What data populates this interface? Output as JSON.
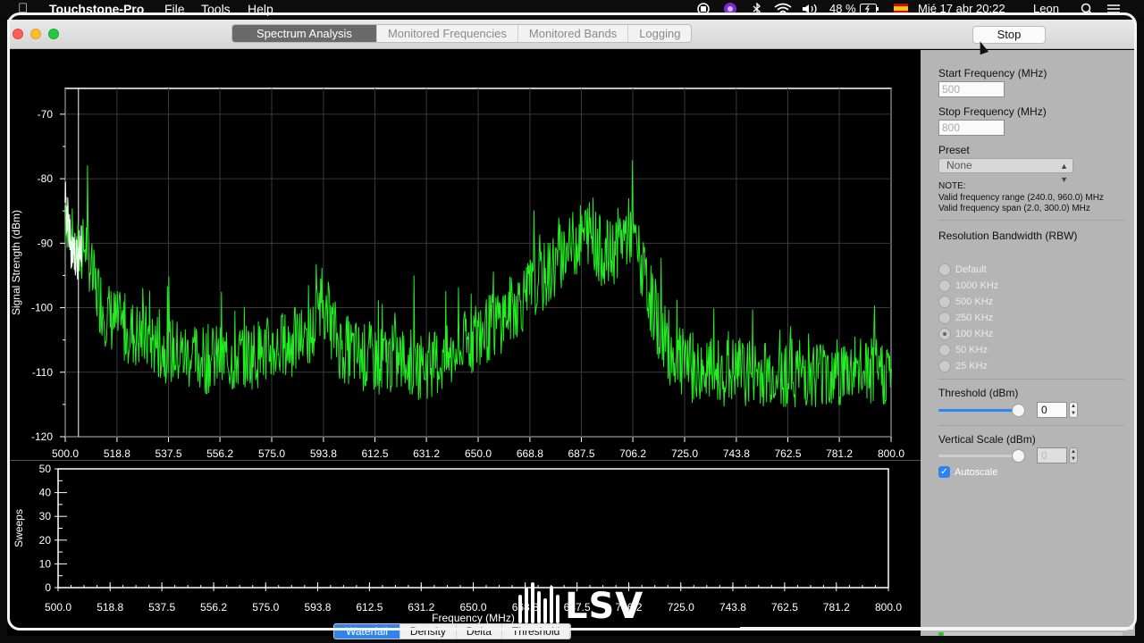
{
  "menubar": {
    "app_name": "Touchstone-Pro",
    "menus": [
      "File",
      "Tools",
      "Help"
    ],
    "battery": "48 %",
    "datetime": "Mié 17 abr  20:22",
    "user": "Leon"
  },
  "window": {
    "tabs": [
      {
        "label": "Spectrum Analysis",
        "active": true
      },
      {
        "label": "Monitored Frequencies",
        "active": false
      },
      {
        "label": "Monitored Bands",
        "active": false
      },
      {
        "label": "Logging",
        "active": false
      }
    ],
    "stop_label": "Stop"
  },
  "panel": {
    "start_freq_label": "Start Frequency (MHz)",
    "start_freq_value": "500",
    "stop_freq_label": "Stop Frequency (MHz)",
    "stop_freq_value": "800",
    "preset_label": "Preset",
    "preset_value": "None",
    "note_title": "NOTE:",
    "note_line1": "Valid frequency range (240.0, 960.0) MHz",
    "note_line2": "Valid frequency span (2.0, 300.0) MHz",
    "rbw_label": "Resolution Bandwidth (RBW)",
    "rbw_options": [
      {
        "label": "Default",
        "selected": false
      },
      {
        "label": "1000 KHz",
        "selected": false
      },
      {
        "label": "500 KHz",
        "selected": false
      },
      {
        "label": "250 KHz",
        "selected": false
      },
      {
        "label": "100 KHz",
        "selected": true
      },
      {
        "label": "50 KHz",
        "selected": false
      },
      {
        "label": "25 KHz",
        "selected": false
      }
    ],
    "threshold_label": "Threshold (dBm)",
    "threshold_value": "0",
    "threshold_level": 0.94,
    "vscale_label": "Vertical Scale (dBm)",
    "vscale_value": "0",
    "vscale_level": 0.94,
    "autoscale_label": "Autoscale",
    "autoscale_checked": true,
    "progress": 0.03
  },
  "view_tabs": [
    {
      "label": "Waterfall",
      "active": true
    },
    {
      "label": "Density",
      "active": false
    },
    {
      "label": "Delta",
      "active": false
    },
    {
      "label": "Threshold",
      "active": false
    }
  ],
  "watermark": {
    "text": "LSV"
  },
  "colors": {
    "trace": "#22ee22",
    "accent": "#2f84ee"
  },
  "chart_data": [
    {
      "type": "line",
      "xlabel": "Frequency (MHz)",
      "ylabel": "Signal Strength (dBm)",
      "xlim": [
        500,
        800
      ],
      "ylim": [
        -120,
        -66
      ],
      "x_ticks": [
        "500.0",
        "518.8",
        "537.5",
        "556.2",
        "575.0",
        "593.8",
        "612.5",
        "631.2",
        "650.0",
        "668.8",
        "687.5",
        "706.2",
        "725.0",
        "743.8",
        "762.5",
        "781.2",
        "800.0"
      ],
      "y_ticks": [
        -70,
        -80,
        -90,
        -100,
        -110,
        -120
      ],
      "grid": true,
      "series": [
        {
          "x": [
            500,
            502,
            504,
            506,
            508,
            510,
            515,
            520,
            525,
            530,
            540,
            550,
            560,
            570,
            580,
            585,
            590,
            593,
            596,
            600,
            605,
            610,
            620,
            630,
            640,
            645,
            650,
            655,
            660,
            665,
            670,
            675,
            680,
            685,
            690,
            694,
            698,
            702,
            706,
            710,
            715,
            720,
            725,
            730,
            740,
            750,
            760,
            770,
            780,
            790,
            800
          ],
          "y": [
            -84,
            -90,
            -92,
            -91,
            -90,
            -96,
            -101,
            -103,
            -104,
            -105,
            -107,
            -108,
            -108,
            -107,
            -106,
            -105,
            -104,
            -98,
            -102,
            -106,
            -107,
            -108,
            -108,
            -109,
            -108,
            -106,
            -104,
            -103,
            -101,
            -99,
            -97,
            -95,
            -92,
            -90,
            -88,
            -91,
            -92,
            -89,
            -88,
            -95,
            -102,
            -107,
            -109,
            -110,
            -110,
            -110,
            -110,
            -110,
            -110,
            -110,
            -110
          ]
        }
      ]
    },
    {
      "type": "heatmap",
      "xlabel": "Frequency (MHz)",
      "ylabel": "Sweeps",
      "xlim": [
        500,
        800
      ],
      "ylim": [
        0,
        50
      ],
      "x_ticks": [
        "500.0",
        "518.8",
        "537.5",
        "556.2",
        "575.0",
        "593.8",
        "612.5",
        "631.2",
        "650.0",
        "668.8",
        "687.5",
        "706.2",
        "725.0",
        "743.8",
        "762.5",
        "781.2",
        "800.0"
      ],
      "y_ticks": [
        0,
        10,
        20,
        30,
        40,
        50
      ]
    }
  ]
}
